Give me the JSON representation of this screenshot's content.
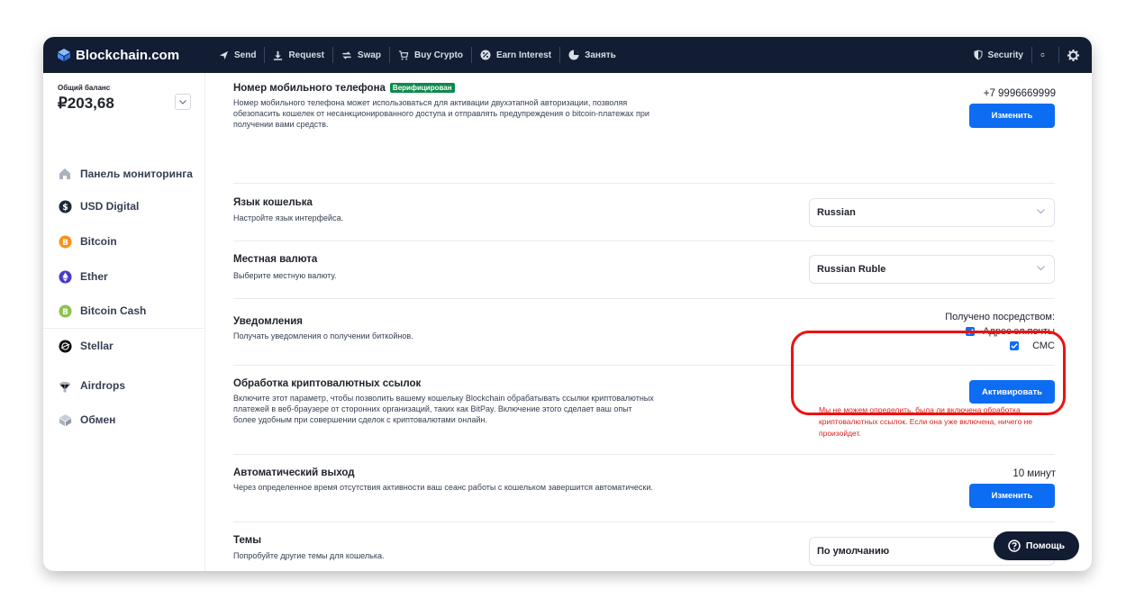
{
  "brand": {
    "name": "Blockchain.com"
  },
  "nav": {
    "items": [
      {
        "label": "Send",
        "icon": "send-icon"
      },
      {
        "label": "Request",
        "icon": "download-icon"
      },
      {
        "label": "Swap",
        "icon": "swap-icon"
      },
      {
        "label": "Buy Crypto",
        "icon": "cart-icon"
      },
      {
        "label": "Earn Interest",
        "icon": "percent-icon"
      },
      {
        "label": "Занять",
        "icon": "pie-icon"
      }
    ],
    "security_label": "Security"
  },
  "sidebar": {
    "balance_label": "Общий баланс",
    "balance_value": "₽203,68",
    "items": [
      {
        "label": "Панель мониторинга",
        "icon": "home-icon"
      },
      {
        "label": "USD Digital",
        "icon": "usd-digital-icon"
      },
      {
        "label": "Bitcoin",
        "icon": "bitcoin-icon"
      },
      {
        "label": "Ether",
        "icon": "ether-icon"
      },
      {
        "label": "Bitcoin Cash",
        "icon": "bitcoin-cash-icon"
      },
      {
        "label": "Stellar",
        "icon": "stellar-icon"
      },
      {
        "label": "Airdrops",
        "icon": "parachute-icon"
      },
      {
        "label": "Обмен",
        "icon": "exchange-icon"
      }
    ]
  },
  "settings": {
    "phone": {
      "title": "Номер мобильного телефона",
      "badge": "Верифицирован",
      "description": "Номер мобильного телефона может использоваться для активации двухэтапной авторизации, позволяя обезопасить кошелек от несанкционированного доступа и отправлять предупреждения о bitcoin-платежах при получении вами средств.",
      "value": "+7 9996669999",
      "button": "Изменить"
    },
    "language": {
      "title": "Язык кошелька",
      "description": "Настройте язык интерфейса.",
      "selected": "Russian"
    },
    "currency": {
      "title": "Местная валюта",
      "description": "Выберите местную валюту.",
      "selected": "Russian Ruble"
    },
    "notifications": {
      "title": "Уведомления",
      "description": "Получать уведомления о получении биткойнов.",
      "received_via": "Получено посредством:",
      "email_label": "Адрес эл.почты",
      "sms_label": "СМС"
    },
    "links": {
      "title": "Обработка криптовалютных ссылок",
      "description": "Включите этот параметр, чтобы позволить вашему кошельку Blockchain обрабатывать ссылки криптовалютных платежей в веб-браузере от сторонних организаций, таких как BitPay. Включение этого сделает ваш опыт более удобным при совершении сделок с криптовалютами онлайн.",
      "button": "Активировать",
      "error": "Мы не можем определить, была ли включена обработка криптовалютных ссылок. Если она уже включена, ничего не произойдет."
    },
    "logout": {
      "title": "Автоматический выход",
      "description": "Через определенное время отсутствия активности ваш сеанс работы с кошельком завершится автоматически.",
      "value": "10 минут",
      "button": "Изменить"
    },
    "theme": {
      "title": "Темы",
      "description": "Попробуйте другие темы для кошелька.",
      "selected": "По умолчанию"
    }
  },
  "help": {
    "label": "Помощь"
  },
  "colors": {
    "topbar": "#121d33",
    "accent": "#0c6cf2",
    "verified": "#0e8a4c",
    "error": "#d8231f",
    "highlight": "#ee1111"
  }
}
